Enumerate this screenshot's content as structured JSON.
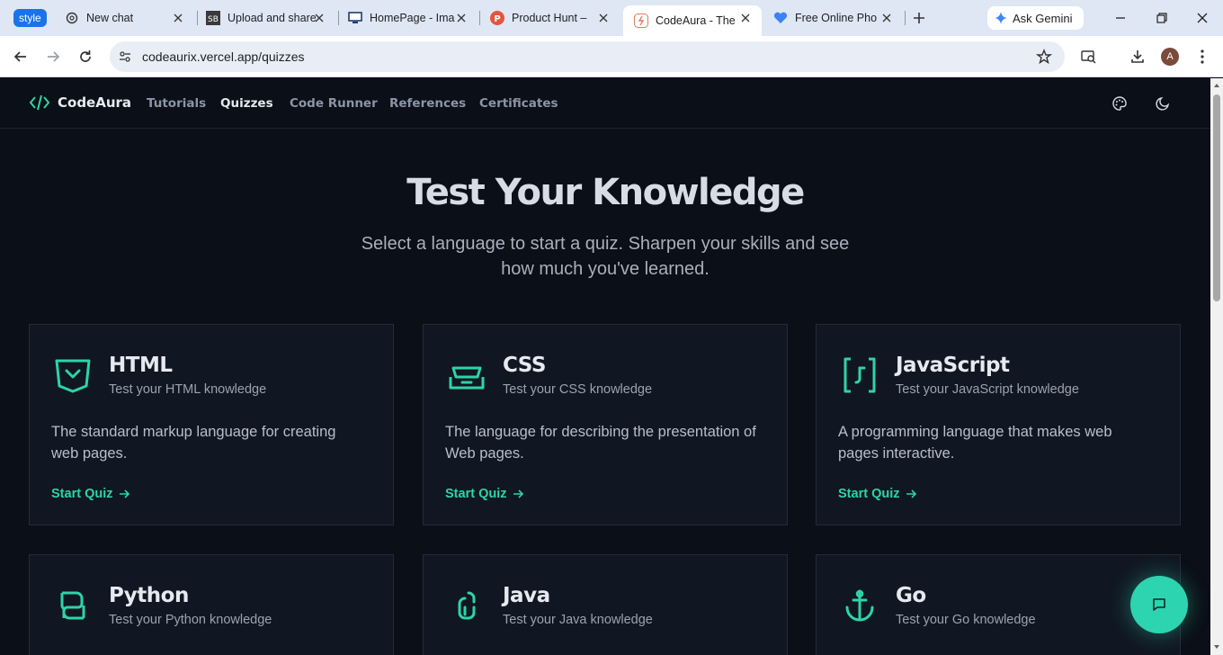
{
  "browser": {
    "style_badge": "style",
    "tabs": [
      {
        "title": "New chat",
        "icon": "openai-icon"
      },
      {
        "title": "Upload and share",
        "icon": "sb-icon"
      },
      {
        "title": "HomePage - Ima",
        "icon": "monitor-icon"
      },
      {
        "title": "Product Hunt –",
        "icon": "producthunt-icon"
      },
      {
        "title": "CodeAura - The",
        "icon": "codeaura-icon",
        "active": true
      },
      {
        "title": "Free Online Pho",
        "icon": "heart-icon"
      }
    ],
    "gemini_label": "Ask Gemini",
    "url": "codeaurix.vercel.app/quizzes",
    "avatar_letter": "A"
  },
  "site": {
    "brand": "CodeAura",
    "accent": "#2dd4a7",
    "nav": [
      {
        "label": "Tutorials",
        "active": false
      },
      {
        "label": "Quizzes",
        "active": true
      },
      {
        "label": "Code Runner",
        "active": false
      },
      {
        "label": "References",
        "active": false
      },
      {
        "label": "Certificates",
        "active": false
      }
    ]
  },
  "hero": {
    "title": "Test Your Knowledge",
    "subtitle_line1": "Select a language to start a quiz. Sharpen your skills and see",
    "subtitle_line2": "how much you've learned."
  },
  "quizzes": [
    {
      "name": "HTML",
      "subtitle": "Test your HTML knowledge",
      "description": "The standard markup language for creating web pages.",
      "action": "Start Quiz",
      "icon": "html5-icon"
    },
    {
      "name": "CSS",
      "subtitle": "Test your CSS knowledge",
      "description": "The language for describing the presentation of Web pages.",
      "action": "Start Quiz",
      "icon": "css3-icon"
    },
    {
      "name": "JavaScript",
      "subtitle": "Test your JavaScript knowledge",
      "description": "A programming language that makes web pages interactive.",
      "action": "Start Quiz",
      "icon": "javascript-icon"
    },
    {
      "name": "Python",
      "subtitle": "Test your Python knowledge",
      "description": "",
      "action": "",
      "icon": "python-icon"
    },
    {
      "name": "Java",
      "subtitle": "Test your Java knowledge",
      "description": "",
      "action": "",
      "icon": "java-icon"
    },
    {
      "name": "Go",
      "subtitle": "Test your Go knowledge",
      "description": "",
      "action": "",
      "icon": "go-icon"
    }
  ]
}
